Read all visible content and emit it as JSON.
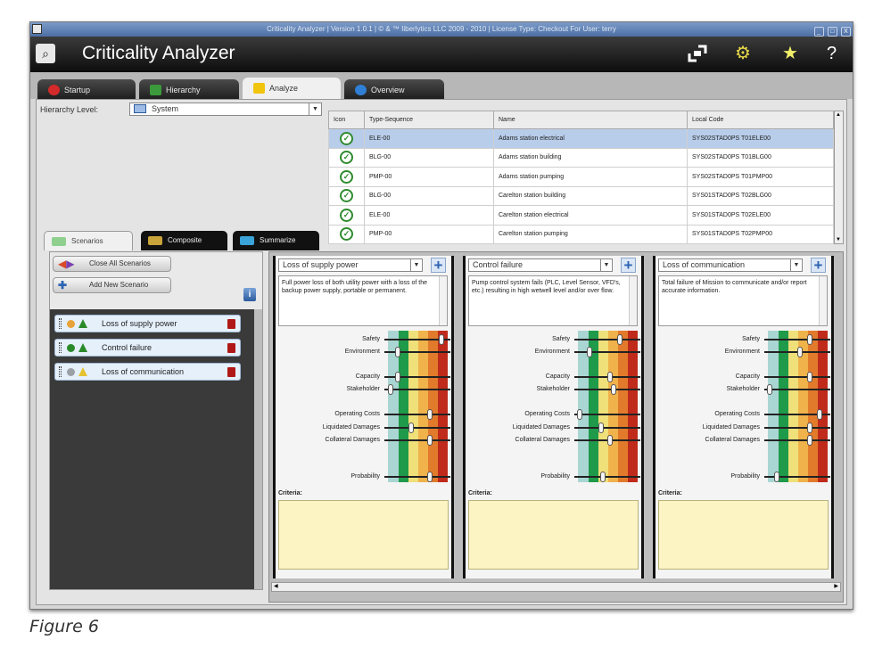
{
  "window": {
    "system_title": "Criticality Analyzer  |  Version 1.0.1  |  © & ™ Iiberlytics LLC 2009 - 2010  |  License Type: Checkout  For User: terry",
    "sysbtn_min": "_",
    "sysbtn_max": "□",
    "sysbtn_close": "X"
  },
  "appbar": {
    "title": "Criticality Analyzer",
    "icons": {
      "search": "search-icon",
      "expand": "expand-icon",
      "settings": "gear-icon",
      "favorite": "star-icon",
      "help": "help-icon"
    },
    "help_glyph": "?"
  },
  "tabs": [
    {
      "label": "Startup",
      "color": "#d42a2a"
    },
    {
      "label": "Hierarchy",
      "color": "#3b9a3b"
    },
    {
      "label": "Analyze",
      "color": "#f1c40f"
    },
    {
      "label": "Overview",
      "color": "#2f7fd6"
    }
  ],
  "hierarchy": {
    "label": "Hierarchy Level:",
    "value": "System"
  },
  "grid": {
    "headers": [
      "Icon",
      "Type-Sequence",
      "Name",
      "Local Code"
    ],
    "rows": [
      {
        "type": "ELE-00",
        "name": "Adams station electrical",
        "code": "SYS02STAD0PS T01ELE00"
      },
      {
        "type": "BLG-00",
        "name": "Adams station building",
        "code": "SYS02STAD0PS T01BLG00"
      },
      {
        "type": "PMP-00",
        "name": "Adams station pumping",
        "code": "SYS02STAD0PS T01PMP00"
      },
      {
        "type": "BLG-00",
        "name": "Carelton station building",
        "code": "SYS01STAD0PS T02BLG00"
      },
      {
        "type": "ELE-00",
        "name": "Carelton station electrical",
        "code": "SYS01STAD0PS T02ELE00"
      },
      {
        "type": "PMP-00",
        "name": "Carelton station pumping",
        "code": "SYS01STAD0PS T02PMP00"
      }
    ]
  },
  "subtabs": [
    {
      "label": "Scenarios"
    },
    {
      "label": "Composite"
    },
    {
      "label": "Summarize"
    }
  ],
  "left": {
    "close_all": "Close All Scenarios",
    "add_new": "Add New Scenario",
    "info": "i",
    "scenarios": [
      {
        "label": "Loss of supply power",
        "dot": "#e8a33a"
      },
      {
        "label": "Control failure",
        "dot": "#2a8a2a"
      },
      {
        "label": "Loss of communication",
        "dot": "#9aa0a6"
      }
    ]
  },
  "cards": [
    {
      "title": "Loss of supply power",
      "desc": "Full power loss of both utility power with a loss of the backup power supply, portable or permanent.",
      "knobs": [
        0.89,
        0.18,
        0.18,
        0.06,
        0.71,
        0.4,
        0.7,
        0.71
      ]
    },
    {
      "title": "Control failure",
      "desc": "Pump control system fails (PLC, Level Sensor, VFD's, etc.) resulting in high wetwell level and/or over flow.",
      "knobs": [
        0.71,
        0.21,
        0.55,
        0.6,
        0.04,
        0.4,
        0.55,
        0.43
      ]
    },
    {
      "title": "Loss of communication",
      "desc": "Total failure of Mission to communicate and/or report accurate information.",
      "knobs": [
        0.71,
        0.55,
        0.71,
        0.04,
        0.87,
        0.71,
        0.71,
        0.16
      ]
    }
  ],
  "factors": [
    "Safety",
    "Environment",
    "Capacity",
    "Stakeholder",
    "Operating Costs",
    "Liquidated Damages",
    "Collateral Damages",
    "Probability"
  ],
  "criteria_label": "Criteria:",
  "heat_colors": [
    "#a9d6d3",
    "#1f9a4a",
    "#efe07a",
    "#f0b24a",
    "#e27a2c",
    "#c02a1a"
  ],
  "caption": "Figure 6"
}
